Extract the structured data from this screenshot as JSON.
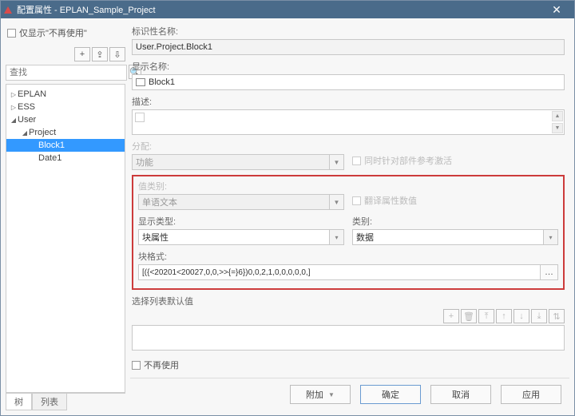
{
  "window": {
    "title": "配置属性 - EPLAN_Sample_Project"
  },
  "left": {
    "only_unused": "仅显示\"不再使用\"",
    "search_placeholder": "查找",
    "tabs": {
      "tree": "树",
      "list": "列表"
    },
    "tree": {
      "n1": "EPLAN",
      "n2": "ESS",
      "n3": "User",
      "n4": "Project",
      "n5": "Block1",
      "n6": "Date1"
    }
  },
  "form": {
    "id_name": {
      "label": "标识性名称:",
      "value": "User.Project.Block1"
    },
    "disp_name": {
      "label": "显示名称:",
      "value": "Block1"
    },
    "desc": {
      "label": "描述:"
    },
    "assign": {
      "label": "分配:",
      "value": "功能",
      "chk": "同时针对部件参考激活"
    },
    "valcat": {
      "label": "值类别:",
      "value": "单语文本",
      "chk": "翻译属性数值"
    },
    "disptype": {
      "label": "显示类型:",
      "value": "块属性"
    },
    "category": {
      "label": "类别:",
      "value": "数据"
    },
    "blockfmt": {
      "label": "块格式:",
      "value": "[({<20201<20027,0,0,>>{=}6})0,0,2,1,0,0,0,0,0,]"
    },
    "listdef": {
      "label": "选择列表默认值"
    },
    "nouse": "不再使用"
  },
  "footer": {
    "add": "附加",
    "ok": "确定",
    "cancel": "取消",
    "apply": "应用"
  },
  "icons": {
    "plus": "+",
    "export": "⇪",
    "import": "⇩",
    "search": "🔍",
    "trash": "🗑",
    "up": "↑",
    "down": "↓",
    "top": "⤒",
    "bot": "⤓",
    "swap": "⇅"
  }
}
